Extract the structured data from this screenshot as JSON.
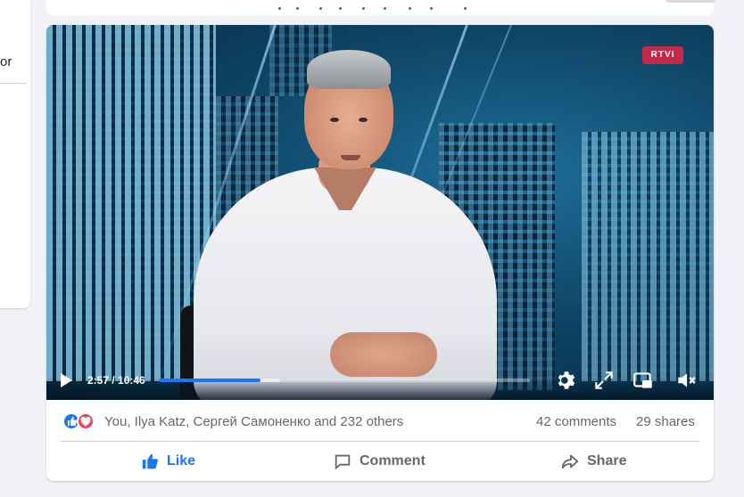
{
  "left_panel": {
    "fragment_text": "or"
  },
  "video": {
    "channel_logo": "RTVI",
    "current_time": "2:57",
    "duration": "10:46",
    "time_display": "2:57 / 10:46",
    "progress_fraction": 0.274,
    "buffered_fraction": 0.327,
    "icons": [
      "play-icon",
      "settings-icon",
      "fullscreen-icon",
      "picture-in-picture-icon",
      "mute-icon"
    ]
  },
  "post": {
    "reactions": {
      "icons": [
        "like-reaction-icon",
        "love-reaction-icon"
      ],
      "text": "You, Ilya Katz, Сергей Самоненко and 232 others"
    },
    "comments_count": "42 comments",
    "shares_count": "29 shares",
    "actions": {
      "like": "Like",
      "comment": "Comment",
      "share": "Share"
    }
  },
  "colors": {
    "accent": "#1877f2",
    "love": "#f33e58",
    "muted_text": "#65676b",
    "logo": "#c4294a"
  }
}
